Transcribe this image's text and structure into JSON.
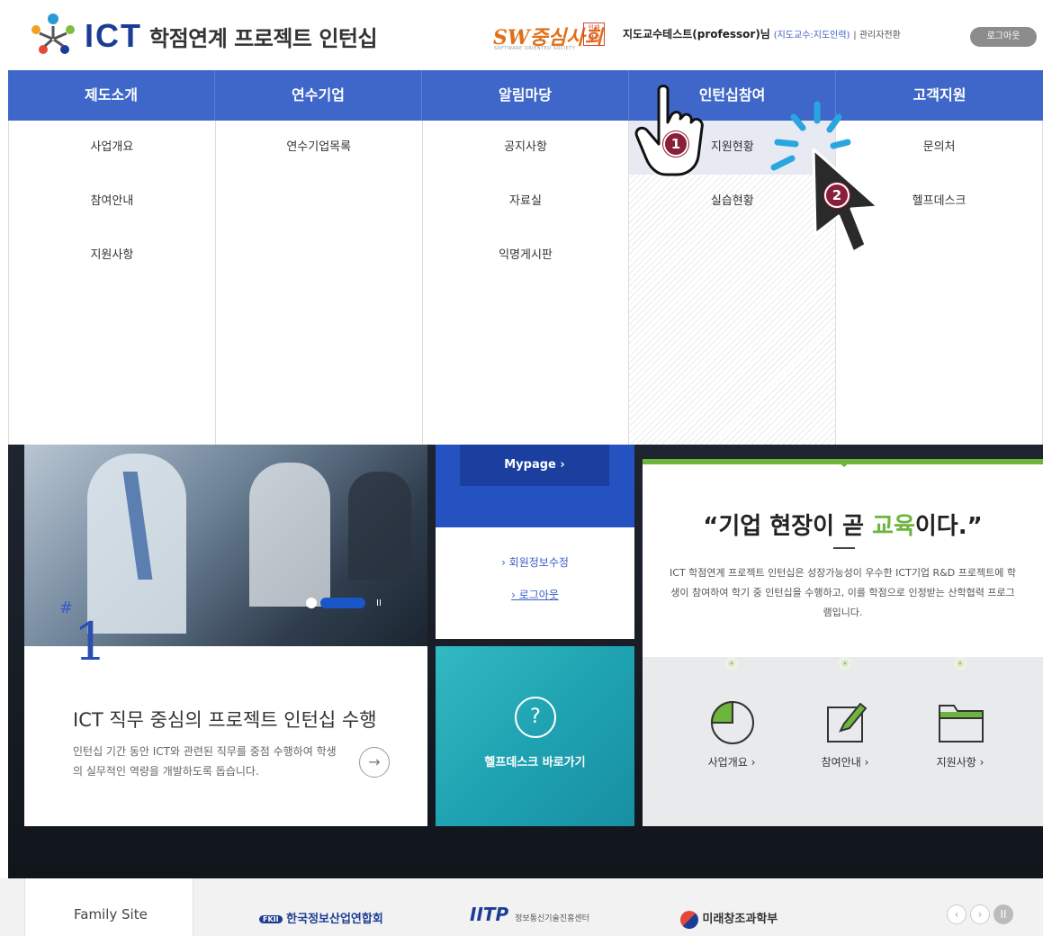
{
  "header": {
    "logo_ict": "ICT",
    "logo_text": "학점연계 프로젝트 인턴십",
    "sw_logo": "SW중심사회",
    "sw_sub": "SOFTWARE ORIENTED SOCIETY",
    "user_name": "지도교수테스트(professor)님",
    "user_role": "(지도교수:지도인력)",
    "admin_link": "관리자전환",
    "logout": "로그아웃"
  },
  "gnb": [
    {
      "label": "제도소개"
    },
    {
      "label": "연수기업"
    },
    {
      "label": "알림마당"
    },
    {
      "label": "인턴십참여"
    },
    {
      "label": "고객지원"
    }
  ],
  "mega": {
    "col1": [
      "사업개요",
      "참여안내",
      "지원사항"
    ],
    "col2": [
      "연수기업목록"
    ],
    "col3": [
      "공지사항",
      "자료실",
      "익명게시판"
    ],
    "col4": [
      "지원현황",
      "실습현황"
    ],
    "col5": [
      "문의처",
      "헬프데스크"
    ]
  },
  "hero": {
    "number": "1",
    "hash": "#",
    "title": "ICT 직무 중심의 프로젝트 인턴십 수행",
    "desc": "인턴십 기간 동안 ICT와 관련된 직무를 중점 수행하여 학생의 실무적인 역량을 개발하도록 돕습니다.",
    "arrow": "→",
    "pause": "II"
  },
  "mypage": {
    "button": "Mypage ›",
    "link1": "› 회원정보수정",
    "link2": "› 로그아웃"
  },
  "help": {
    "icon": "?",
    "label": "헬프데스크 바로가기"
  },
  "slogan": {
    "open": "“기업 현장이 곧 ",
    "highlight": "교육",
    "close": "이다.”",
    "desc": "ICT 학점연계 프로젝트 인턴십은 성장가능성이 우수한 ICT기업 R&D 프로젝트에 학생이 참여하여 학기 중 인턴십을 수행하고, 이를 학점으로 인정받는 산학협력 프로그램입니다."
  },
  "biz_links": [
    {
      "label": "사업개요 ›",
      "icon": "pie-chart-icon"
    },
    {
      "label": "참여안내 ›",
      "icon": "edit-icon"
    },
    {
      "label": "지원사항 ›",
      "icon": "folder-icon"
    }
  ],
  "footer": {
    "family": "Family Site",
    "fkii": "한국정보산업연합회",
    "fkii_badge": "FKII",
    "iitp": "IITP",
    "iitp_sub": "정보통신기술진흥센터",
    "msip": "미래창조과학부",
    "prev": "‹",
    "next": "›",
    "pause": "II"
  },
  "annotations": {
    "step1": "1",
    "step2": "2"
  },
  "colors": {
    "gnb": "#3f67c9",
    "green": "#6eb53e",
    "teal": "#1fa3b2",
    "badge": "#8a1f3a"
  }
}
